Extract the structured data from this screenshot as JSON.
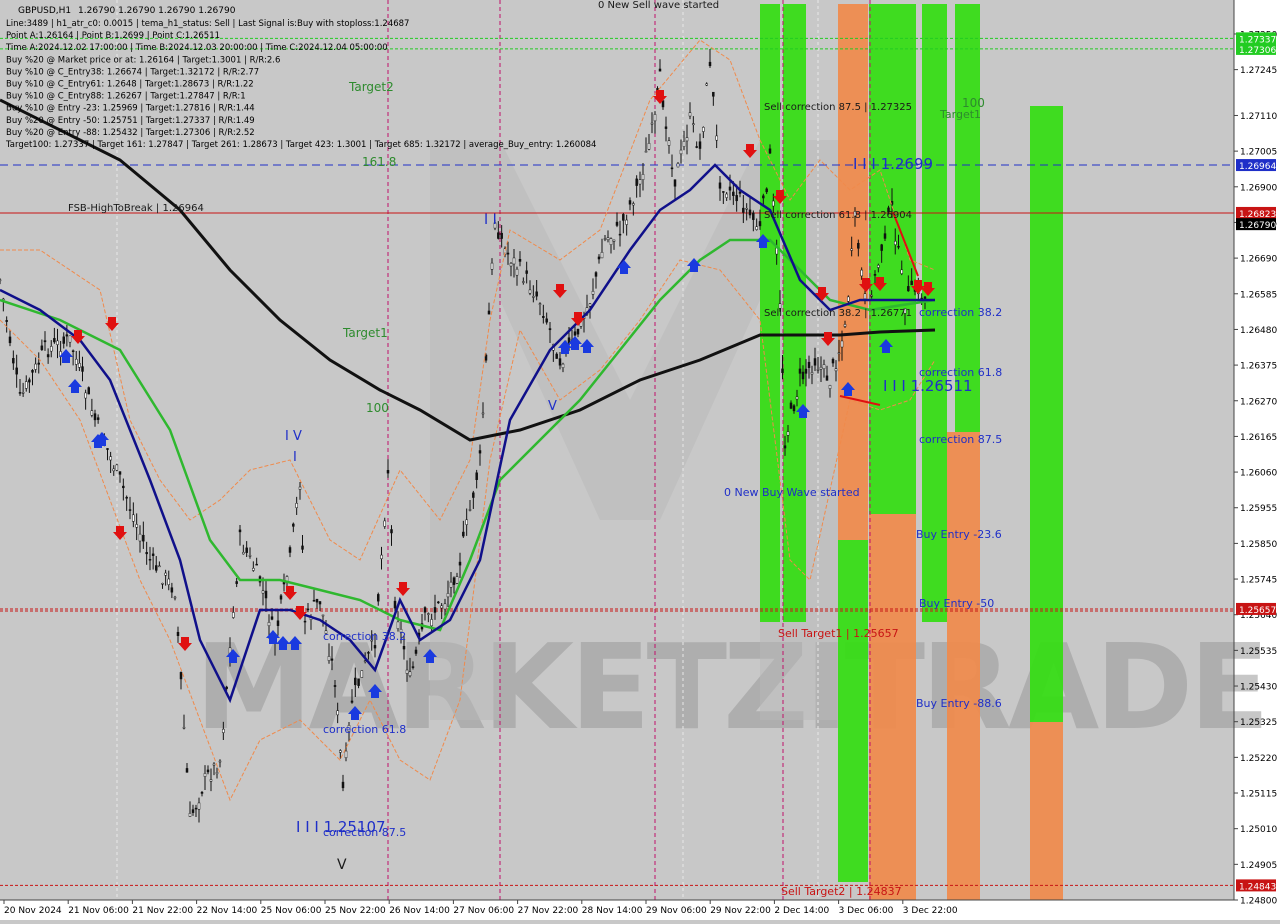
{
  "chart_data": {
    "type": "line",
    "symbol": "GBPUSD,H1",
    "ohlc": "1.26790 1.26790 1.26790 1.26790",
    "info_lines": [
      "Line:3489 | h1_atr_c0: 0.0015 | tema_h1_status: Sell | Last Signal is:Buy with stoploss:1.24687",
      "Point A:1.26164 | Point B:1.2699 | Point C:1.26511",
      "Time A:2024.12.02 17:00:00 | Time B:2024.12.03 20:00:00 | Time C:2024.12.04 05:00:00",
      "Buy %20 @ Market price or at: 1.26164 | Target:1.3001 | R/R:2.6",
      "Buy %10 @ C_Entry38: 1.26674 | Target:1.32172 | R/R:2.77",
      "Buy %10 @ C_Entry61: 1.2648 | Target:1.28673 | R/R:1.22",
      "Buy %10 @ C_Entry88: 1.26267 | Target:1.27847 | R/R:1",
      "Buy %10 @ Entry -23: 1.25969 | Target:1.27816 | R/R:1.44",
      "Buy %20 @ Entry -50: 1.25751 | Target:1.27337 | R/R:1.49",
      "Buy %20 @ Entry -88: 1.25432 | Target:1.27306 | R/R:2.52",
      "Target100: 1.27337 | Target 161: 1.27847 | Target 261: 1.28673 | Target 423: 1.3001 | Target 685: 1.32172 | average_Buy_entry: 1.260084"
    ],
    "y_ticks": [
      "1.27350",
      "1.27245",
      "1.27110",
      "1.27005",
      "1.26900",
      "1.26795",
      "1.26690",
      "1.26585",
      "1.26480",
      "1.26375",
      "1.26270",
      "1.26165",
      "1.26060",
      "1.25955",
      "1.25850",
      "1.25745",
      "1.25640",
      "1.25535",
      "1.25430",
      "1.25325",
      "1.25220",
      "1.25115",
      "1.25010",
      "1.24905",
      "1.24800"
    ],
    "x_ticks": [
      "20 Nov 2024",
      "21 Nov 06:00",
      "21 Nov 22:00",
      "22 Nov 14:00",
      "25 Nov 06:00",
      "25 Nov 22:00",
      "26 Nov 14:00",
      "27 Nov 06:00",
      "27 Nov 22:00",
      "28 Nov 14:00",
      "29 Nov 06:00",
      "29 Nov 22:00",
      "2 Dec 14:00",
      "3 Dec 06:00",
      "3 Dec 22:00"
    ],
    "price_labels": [
      {
        "text": "1.27337",
        "value": 1.27337,
        "color": "#22cc22"
      },
      {
        "text": "1.27306",
        "value": 1.27306,
        "color": "#22cc22"
      },
      {
        "text": "1.26964",
        "value": 1.26964,
        "color": "#1f2fc8"
      },
      {
        "text": "1.26823",
        "value": 1.26823,
        "color": "#c81414"
      },
      {
        "text": "1.26790",
        "value": 1.2679,
        "color": "#000000"
      },
      {
        "text": "1.25657",
        "value": 1.25657,
        "color": "#c81414"
      },
      {
        "text": "1.24843",
        "value": 1.24843,
        "color": "#c81414"
      }
    ],
    "annotations": [
      {
        "text": "0 New Sell wave started",
        "color": "#1a1a1a"
      },
      {
        "text": "Target2",
        "color": "#2e8b2e"
      },
      {
        "text": "161.8",
        "color": "#2e8b2e"
      },
      {
        "text": "FSB-HighToBreak | 1.26964",
        "color": "#1a1a1a"
      },
      {
        "text": "Target1",
        "color": "#2e8b2e"
      },
      {
        "text": "100",
        "color": "#2e8b2e"
      },
      {
        "text": "I V",
        "color": "#1f2fc8"
      },
      {
        "text": "I",
        "color": "#1f2fc8"
      },
      {
        "text": "I I",
        "color": "#1f2fc8"
      },
      {
        "text": "V",
        "color": "#1f2fc8"
      },
      {
        "text": "Sell correction 87.5 | 1.27325",
        "color": "#1a1a1a"
      },
      {
        "text": "I I I 1.2699",
        "color": "#1f2fc8"
      },
      {
        "text": "Sell correction 61.8 | 1.26904",
        "color": "#1a1a1a"
      },
      {
        "text": "Sell correction 38.2 | 1.26771",
        "color": "#1a1a1a"
      },
      {
        "text": "correction 38.2",
        "color": "#1f2fc8"
      },
      {
        "text": "correction 61.8",
        "color": "#1f2fc8"
      },
      {
        "text": "I I I 1.26511",
        "color": "#1f2fc8"
      },
      {
        "text": "correction 87.5",
        "color": "#1f2fc8"
      },
      {
        "text": "0 New Buy Wave started",
        "color": "#1f2fc8"
      },
      {
        "text": "Buy Entry -23.6",
        "color": "#1f2fc8"
      },
      {
        "text": "Buy Entry -50",
        "color": "#1f2fc8"
      },
      {
        "text": "Sell Target1 | 1.25657",
        "color": "#c81414"
      },
      {
        "text": "Buy Entry -88.6",
        "color": "#1f2fc8"
      },
      {
        "text": "correction 38.2",
        "color": "#1f2fc8"
      },
      {
        "text": "correction 61.8",
        "color": "#1f2fc8"
      },
      {
        "text": "I I I 1.25107",
        "color": "#1f2fc8"
      },
      {
        "text": "correction 87.5",
        "color": "#1f2fc8"
      },
      {
        "text": "V",
        "color": "#1a1a1a"
      },
      {
        "text": "Sell Target2 | 1.24837",
        "color": "#c81414"
      },
      {
        "text": "100",
        "color": "#2e8b2e"
      },
      {
        "text": "Target1",
        "color": "#2e8b2e"
      }
    ],
    "watermark": "MARKETZITRADE",
    "ylim": [
      1.248,
      1.2745
    ],
    "colors": {
      "background": "#c8c8c8",
      "ema_fast": "#10108a",
      "ema_slow": "#2fb82f",
      "ema_long": "#111111",
      "sell_arrow": "#e01010",
      "buy_arrow": "#1a3adf",
      "zone_green": "#33dd11",
      "zone_orange": "#f08a4b"
    }
  }
}
